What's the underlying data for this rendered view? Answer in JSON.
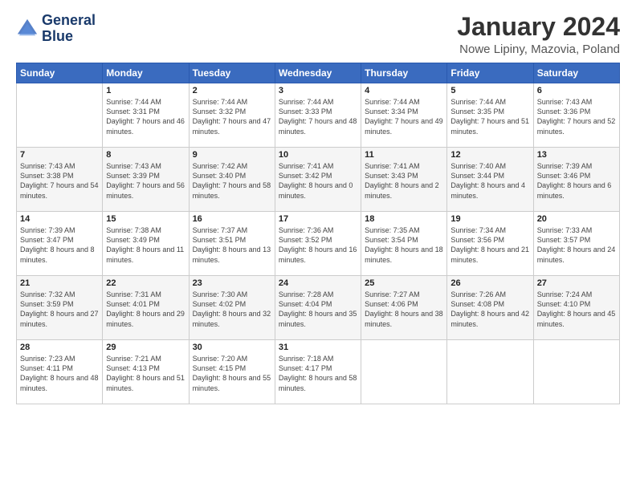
{
  "logo": {
    "line1": "General",
    "line2": "Blue"
  },
  "title": "January 2024",
  "subtitle": "Nowe Lipiny, Mazovia, Poland",
  "headers": [
    "Sunday",
    "Monday",
    "Tuesday",
    "Wednesday",
    "Thursday",
    "Friday",
    "Saturday"
  ],
  "weeks": [
    [
      {
        "day": "",
        "sunrise": "",
        "sunset": "",
        "daylight": ""
      },
      {
        "day": "1",
        "sunrise": "Sunrise: 7:44 AM",
        "sunset": "Sunset: 3:31 PM",
        "daylight": "Daylight: 7 hours and 46 minutes."
      },
      {
        "day": "2",
        "sunrise": "Sunrise: 7:44 AM",
        "sunset": "Sunset: 3:32 PM",
        "daylight": "Daylight: 7 hours and 47 minutes."
      },
      {
        "day": "3",
        "sunrise": "Sunrise: 7:44 AM",
        "sunset": "Sunset: 3:33 PM",
        "daylight": "Daylight: 7 hours and 48 minutes."
      },
      {
        "day": "4",
        "sunrise": "Sunrise: 7:44 AM",
        "sunset": "Sunset: 3:34 PM",
        "daylight": "Daylight: 7 hours and 49 minutes."
      },
      {
        "day": "5",
        "sunrise": "Sunrise: 7:44 AM",
        "sunset": "Sunset: 3:35 PM",
        "daylight": "Daylight: 7 hours and 51 minutes."
      },
      {
        "day": "6",
        "sunrise": "Sunrise: 7:43 AM",
        "sunset": "Sunset: 3:36 PM",
        "daylight": "Daylight: 7 hours and 52 minutes."
      }
    ],
    [
      {
        "day": "7",
        "sunrise": "Sunrise: 7:43 AM",
        "sunset": "Sunset: 3:38 PM",
        "daylight": "Daylight: 7 hours and 54 minutes."
      },
      {
        "day": "8",
        "sunrise": "Sunrise: 7:43 AM",
        "sunset": "Sunset: 3:39 PM",
        "daylight": "Daylight: 7 hours and 56 minutes."
      },
      {
        "day": "9",
        "sunrise": "Sunrise: 7:42 AM",
        "sunset": "Sunset: 3:40 PM",
        "daylight": "Daylight: 7 hours and 58 minutes."
      },
      {
        "day": "10",
        "sunrise": "Sunrise: 7:41 AM",
        "sunset": "Sunset: 3:42 PM",
        "daylight": "Daylight: 8 hours and 0 minutes."
      },
      {
        "day": "11",
        "sunrise": "Sunrise: 7:41 AM",
        "sunset": "Sunset: 3:43 PM",
        "daylight": "Daylight: 8 hours and 2 minutes."
      },
      {
        "day": "12",
        "sunrise": "Sunrise: 7:40 AM",
        "sunset": "Sunset: 3:44 PM",
        "daylight": "Daylight: 8 hours and 4 minutes."
      },
      {
        "day": "13",
        "sunrise": "Sunrise: 7:39 AM",
        "sunset": "Sunset: 3:46 PM",
        "daylight": "Daylight: 8 hours and 6 minutes."
      }
    ],
    [
      {
        "day": "14",
        "sunrise": "Sunrise: 7:39 AM",
        "sunset": "Sunset: 3:47 PM",
        "daylight": "Daylight: 8 hours and 8 minutes."
      },
      {
        "day": "15",
        "sunrise": "Sunrise: 7:38 AM",
        "sunset": "Sunset: 3:49 PM",
        "daylight": "Daylight: 8 hours and 11 minutes."
      },
      {
        "day": "16",
        "sunrise": "Sunrise: 7:37 AM",
        "sunset": "Sunset: 3:51 PM",
        "daylight": "Daylight: 8 hours and 13 minutes."
      },
      {
        "day": "17",
        "sunrise": "Sunrise: 7:36 AM",
        "sunset": "Sunset: 3:52 PM",
        "daylight": "Daylight: 8 hours and 16 minutes."
      },
      {
        "day": "18",
        "sunrise": "Sunrise: 7:35 AM",
        "sunset": "Sunset: 3:54 PM",
        "daylight": "Daylight: 8 hours and 18 minutes."
      },
      {
        "day": "19",
        "sunrise": "Sunrise: 7:34 AM",
        "sunset": "Sunset: 3:56 PM",
        "daylight": "Daylight: 8 hours and 21 minutes."
      },
      {
        "day": "20",
        "sunrise": "Sunrise: 7:33 AM",
        "sunset": "Sunset: 3:57 PM",
        "daylight": "Daylight: 8 hours and 24 minutes."
      }
    ],
    [
      {
        "day": "21",
        "sunrise": "Sunrise: 7:32 AM",
        "sunset": "Sunset: 3:59 PM",
        "daylight": "Daylight: 8 hours and 27 minutes."
      },
      {
        "day": "22",
        "sunrise": "Sunrise: 7:31 AM",
        "sunset": "Sunset: 4:01 PM",
        "daylight": "Daylight: 8 hours and 29 minutes."
      },
      {
        "day": "23",
        "sunrise": "Sunrise: 7:30 AM",
        "sunset": "Sunset: 4:02 PM",
        "daylight": "Daylight: 8 hours and 32 minutes."
      },
      {
        "day": "24",
        "sunrise": "Sunrise: 7:28 AM",
        "sunset": "Sunset: 4:04 PM",
        "daylight": "Daylight: 8 hours and 35 minutes."
      },
      {
        "day": "25",
        "sunrise": "Sunrise: 7:27 AM",
        "sunset": "Sunset: 4:06 PM",
        "daylight": "Daylight: 8 hours and 38 minutes."
      },
      {
        "day": "26",
        "sunrise": "Sunrise: 7:26 AM",
        "sunset": "Sunset: 4:08 PM",
        "daylight": "Daylight: 8 hours and 42 minutes."
      },
      {
        "day": "27",
        "sunrise": "Sunrise: 7:24 AM",
        "sunset": "Sunset: 4:10 PM",
        "daylight": "Daylight: 8 hours and 45 minutes."
      }
    ],
    [
      {
        "day": "28",
        "sunrise": "Sunrise: 7:23 AM",
        "sunset": "Sunset: 4:11 PM",
        "daylight": "Daylight: 8 hours and 48 minutes."
      },
      {
        "day": "29",
        "sunrise": "Sunrise: 7:21 AM",
        "sunset": "Sunset: 4:13 PM",
        "daylight": "Daylight: 8 hours and 51 minutes."
      },
      {
        "day": "30",
        "sunrise": "Sunrise: 7:20 AM",
        "sunset": "Sunset: 4:15 PM",
        "daylight": "Daylight: 8 hours and 55 minutes."
      },
      {
        "day": "31",
        "sunrise": "Sunrise: 7:18 AM",
        "sunset": "Sunset: 4:17 PM",
        "daylight": "Daylight: 8 hours and 58 minutes."
      },
      {
        "day": "",
        "sunrise": "",
        "sunset": "",
        "daylight": ""
      },
      {
        "day": "",
        "sunrise": "",
        "sunset": "",
        "daylight": ""
      },
      {
        "day": "",
        "sunrise": "",
        "sunset": "",
        "daylight": ""
      }
    ]
  ]
}
